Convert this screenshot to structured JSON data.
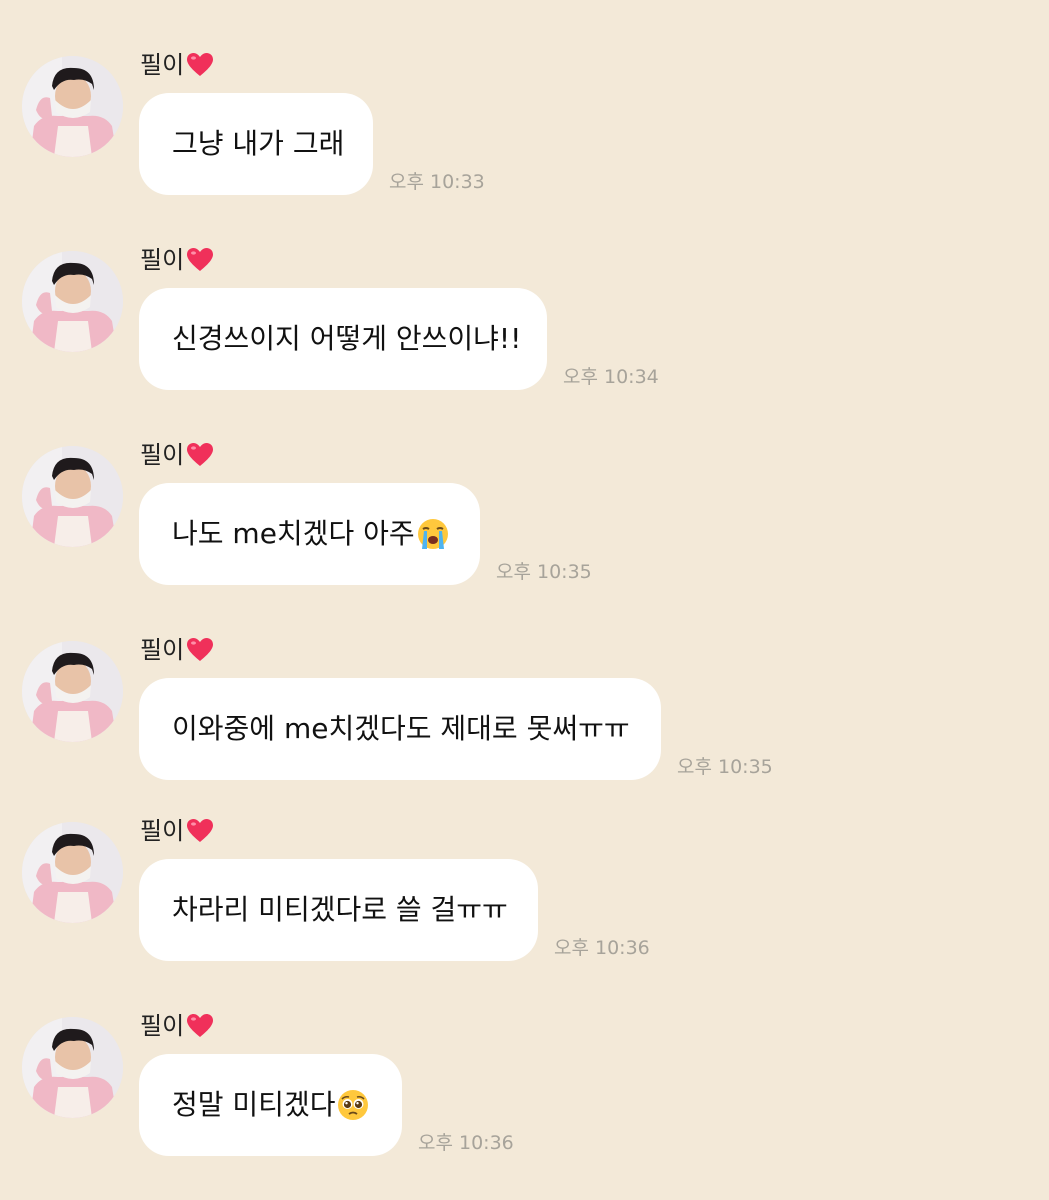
{
  "chat": {
    "messages": [
      {
        "sender": "필이",
        "text": "그냥 내가 그래",
        "time": "오후 10:33",
        "emoji": ""
      },
      {
        "sender": "필이",
        "text": "신경쓰이지 어떻게 안쓰이냐!!",
        "time": "오후 10:34",
        "emoji": ""
      },
      {
        "sender": "필이",
        "text": "나도 me치겠다 아주",
        "time": "오후 10:35",
        "emoji": "loudly-crying-face-icon"
      },
      {
        "sender": "필이",
        "text": "이와중에 me치겠다도 제대로 못써ㅠㅠ",
        "time": "오후 10:35",
        "emoji": ""
      },
      {
        "sender": "필이",
        "text": "차라리 미티겠다로 쓸 걸ㅠㅠ",
        "time": "오후 10:36",
        "emoji": ""
      },
      {
        "sender": "필이",
        "text": "정말 미티겠다",
        "time": "오후 10:36",
        "emoji": "pleading-face-icon"
      }
    ]
  },
  "colors": {
    "background": "#f3e9d8",
    "bubble": "#ffffff",
    "time_text": "#a7a39a",
    "heart": "#f0305a"
  }
}
